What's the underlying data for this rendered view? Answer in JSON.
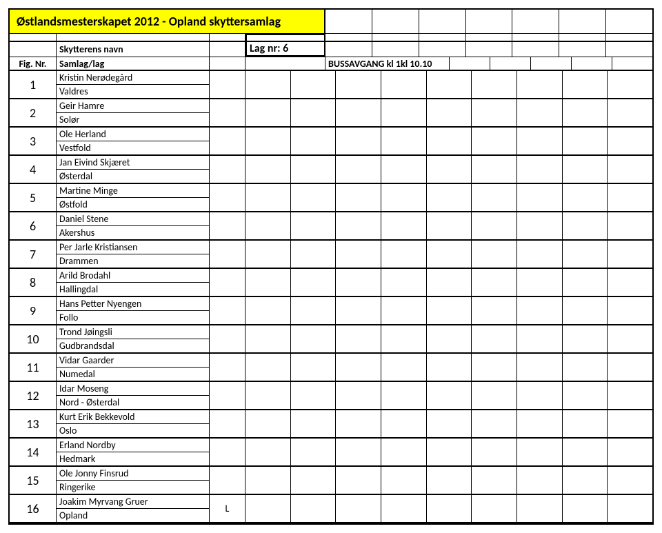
{
  "title": "Østlandsmesterskapet 2012 - Opland skyttersamlag",
  "headers": {
    "fig": "Fig. Nr.",
    "name_line1": "Skytterens navn",
    "name_line2": "Samlag/lag",
    "lag": "Lag nr: 6",
    "bus": "BUSSAVGANG kl 1kl 10.10"
  },
  "gridColsAfterBus": 5,
  "entries": [
    {
      "nr": "1",
      "name": "Kristin Nerødegård",
      "club": "Valdres",
      "flag": ""
    },
    {
      "nr": "2",
      "name": "Geir Hamre",
      "club": "Solør",
      "flag": ""
    },
    {
      "nr": "3",
      "name": "Ole Herland",
      "club": "Vestfold",
      "flag": ""
    },
    {
      "nr": "4",
      "name": "Jan Eivind Skjæret",
      "club": "Østerdal",
      "flag": ""
    },
    {
      "nr": "5",
      "name": "Martine Minge",
      "club": "Østfold",
      "flag": ""
    },
    {
      "nr": "6",
      "name": "Daniel Stene",
      "club": "Akershus",
      "flag": ""
    },
    {
      "nr": "7",
      "name": "Per Jarle Kristiansen",
      "club": "Drammen",
      "flag": ""
    },
    {
      "nr": "8",
      "name": "Arild Brodahl",
      "club": "Hallingdal",
      "flag": ""
    },
    {
      "nr": "9",
      "name": "Hans Petter Nyengen",
      "club": "Follo",
      "flag": ""
    },
    {
      "nr": "10",
      "name": "Trond Jøingsli",
      "club": "Gudbrandsdal",
      "flag": ""
    },
    {
      "nr": "11",
      "name": "Vidar Gaarder",
      "club": "Numedal",
      "flag": ""
    },
    {
      "nr": "12",
      "name": "Idar Moseng",
      "club": "Nord - Østerdal",
      "flag": ""
    },
    {
      "nr": "13",
      "name": "Kurt Erik Bekkevold",
      "club": "Oslo",
      "flag": ""
    },
    {
      "nr": "14",
      "name": "Erland Nordby",
      "club": "Hedmark",
      "flag": ""
    },
    {
      "nr": "15",
      "name": "Ole Jonny Finsrud",
      "club": "Ringerike",
      "flag": ""
    },
    {
      "nr": "16",
      "name": "Joakim Myrvang Gruer",
      "club": "Opland",
      "flag": "L"
    }
  ]
}
